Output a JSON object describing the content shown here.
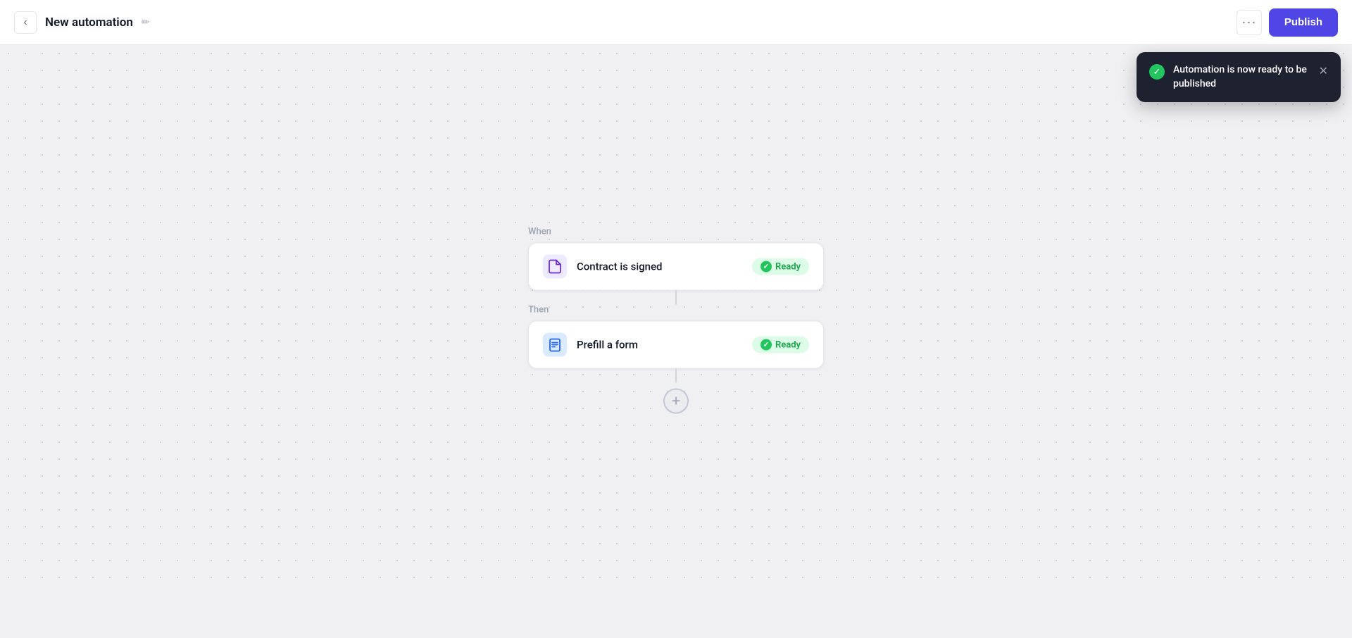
{
  "header": {
    "back_icon": "‹",
    "title": "New automation",
    "edit_icon": "✏",
    "more_icon": "···",
    "publish_label": "Publish"
  },
  "flow": {
    "when_label": "When",
    "then_label": "Then",
    "step1": {
      "label": "Contract is signed",
      "icon": "📄",
      "badge": "Ready"
    },
    "step2": {
      "label": "Prefill a form",
      "icon": "📋",
      "badge": "Ready"
    },
    "add_step_icon": "+"
  },
  "toast": {
    "message": "Automation is now ready to be published",
    "close_icon": "✕"
  }
}
